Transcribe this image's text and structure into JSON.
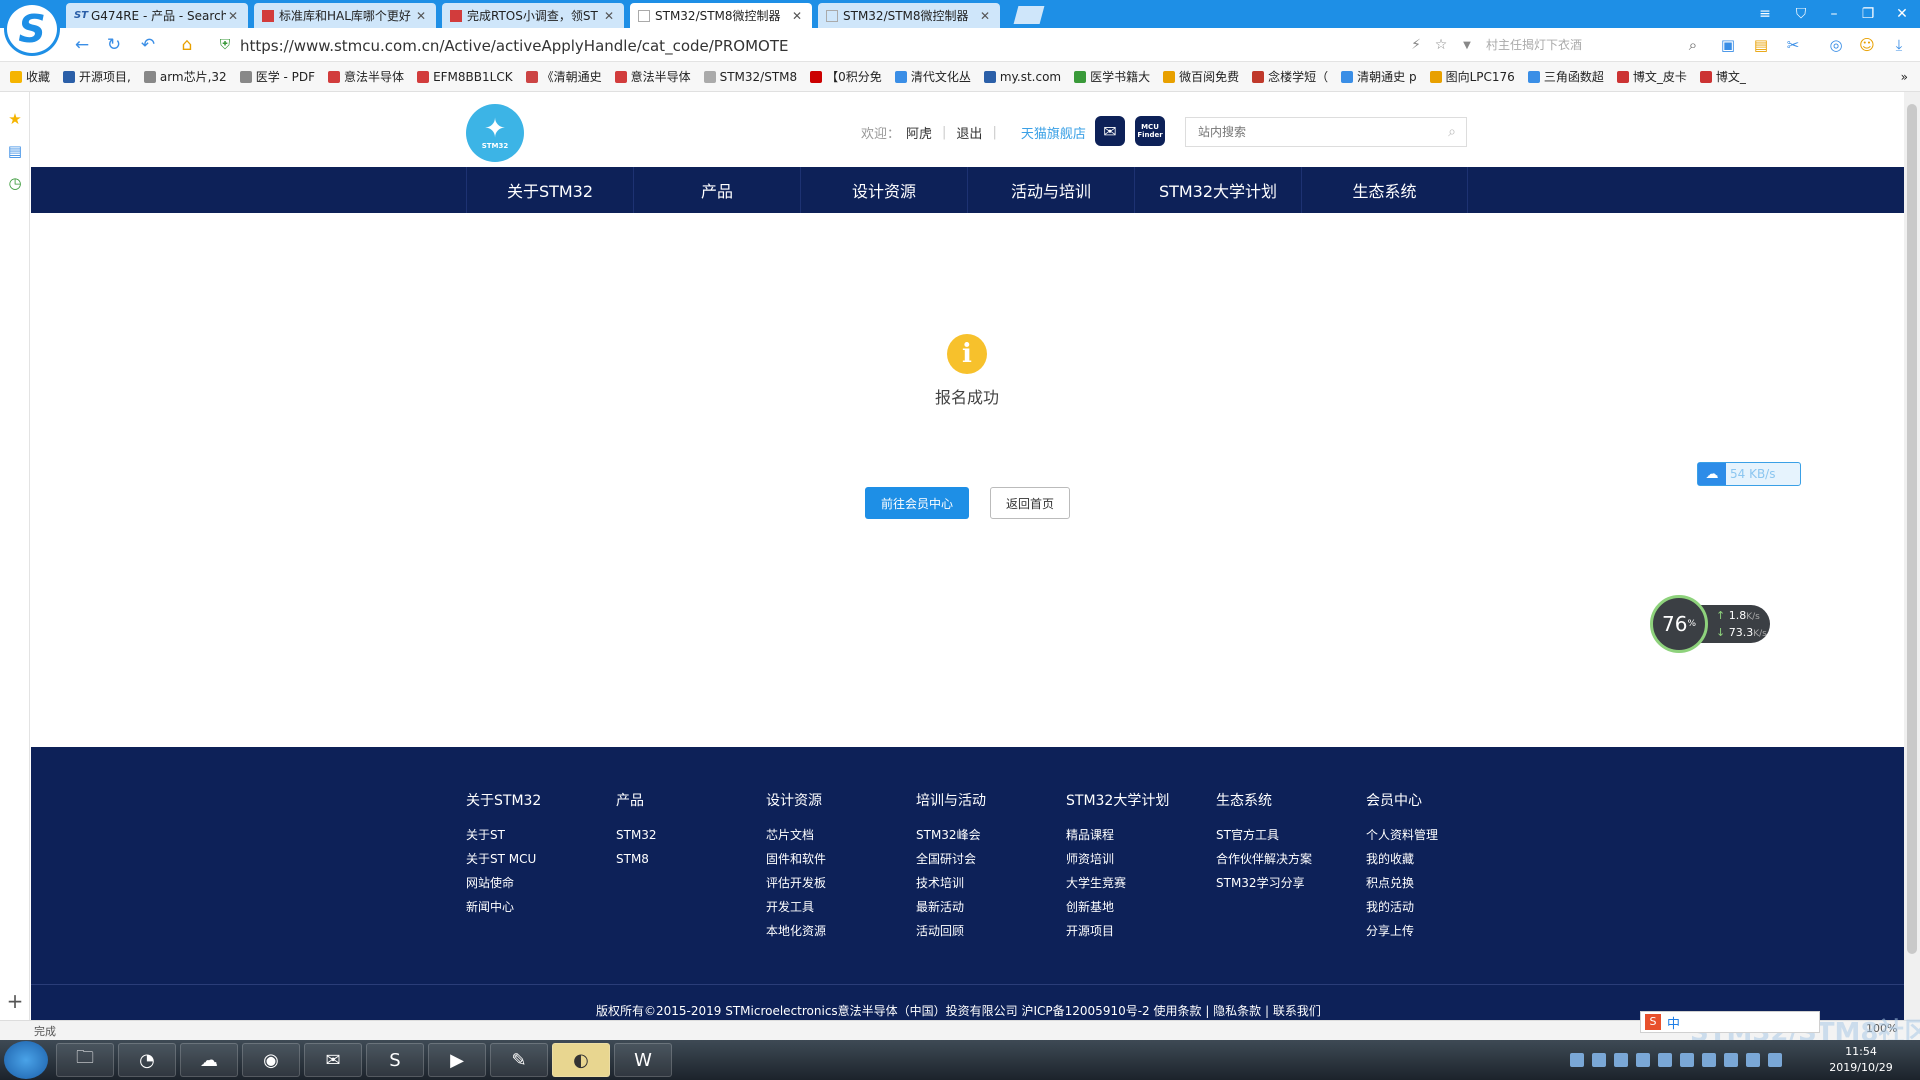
{
  "browser": {
    "logo": "S",
    "tabs": [
      {
        "label": "G474RE - 产品 - Search",
        "icon": "st-icon",
        "active": false
      },
      {
        "label": "标准库和HAL库哪个更好",
        "icon": "grid-icon",
        "active": false
      },
      {
        "label": "完成RTOS小调查，领ST",
        "icon": "grid-icon",
        "active": false
      },
      {
        "label": "STM32/STM8微控制器",
        "icon": "page-icon",
        "active": true
      },
      {
        "label": "STM32/STM8微控制器",
        "icon": "page-icon",
        "active": false
      }
    ],
    "url": "https://www.stmcu.com.cn/Active/activeApplyHandle/cat_code/PROMOTE",
    "search_placeholder": "村主任揭灯下衣酒",
    "bookmarks": [
      {
        "label": "收藏",
        "color": "#f5b400"
      },
      {
        "label": "开源项目,",
        "color": "#2b5fa8"
      },
      {
        "label": "arm芯片,32",
        "color": "#888888"
      },
      {
        "label": "医学 - PDF",
        "color": "#888888"
      },
      {
        "label": "意法半导体",
        "color": "#d23c3c"
      },
      {
        "label": "EFM8BB1LCK",
        "color": "#d23c3c"
      },
      {
        "label": "《清朝通史",
        "color": "#c44"
      },
      {
        "label": "意法半导体",
        "color": "#d23c3c"
      },
      {
        "label": "STM32/STM8",
        "color": "#aaaaaa"
      },
      {
        "label": "【0积分免",
        "color": "#cc0000"
      },
      {
        "label": "清代文化丛",
        "color": "#3a8ee6"
      },
      {
        "label": "my.st.com",
        "color": "#2b5fa8"
      },
      {
        "label": "医学书籍大",
        "color": "#3a9a3a"
      },
      {
        "label": "微百阅免费",
        "color": "#e8a000"
      },
      {
        "label": "念楼学短（",
        "color": "#c0392b"
      },
      {
        "label": "清朝通史 p",
        "color": "#3a8ee6"
      },
      {
        "label": "图向LPC176",
        "color": "#e8a000"
      },
      {
        "label": "三角函数超",
        "color": "#3a8ee6"
      },
      {
        "label": "博文_皮卡",
        "color": "#cc3333"
      },
      {
        "label": "博文_",
        "color": "#cc3333"
      }
    ],
    "status_text": "完成",
    "zoom": "100%"
  },
  "header": {
    "logo_text": "STM32",
    "welcome": "欢迎：",
    "username": "阿虎",
    "logout": "退出",
    "tmall": "天猫旗舰店",
    "wechat_icon": "wechat-icon",
    "mcu_finder": "MCU Finder",
    "search_placeholder": "站内搜索"
  },
  "nav": [
    {
      "label": "关于STM32"
    },
    {
      "label": "产品"
    },
    {
      "label": "设计资源"
    },
    {
      "label": "活动与培训"
    },
    {
      "label": "STM32大学计划"
    },
    {
      "label": "生态系统"
    }
  ],
  "content": {
    "info_icon": "i",
    "message": "报名成功",
    "btn_member": "前往会员中心",
    "btn_home": "返回首页"
  },
  "footer": {
    "columns": [
      {
        "title": "关于STM32",
        "items": [
          "关于ST",
          "关于ST MCU",
          "网站使命",
          "新闻中心"
        ]
      },
      {
        "title": "产品",
        "items": [
          "STM32",
          "STM8"
        ]
      },
      {
        "title": "设计资源",
        "items": [
          "芯片文档",
          "固件和软件",
          "评估开发板",
          "开发工具",
          "本地化资源"
        ]
      },
      {
        "title": "培训与活动",
        "items": [
          "STM32峰会",
          "全国研讨会",
          "技术培训",
          "最新活动",
          "活动回顾"
        ]
      },
      {
        "title": "STM32大学计划",
        "items": [
          "精品课程",
          "师资培训",
          "大学生竞赛",
          "创新基地",
          "开源项目"
        ]
      },
      {
        "title": "生态系统",
        "items": [
          "ST官方工具",
          "合作伙伴解决方案",
          "STM32学习分享"
        ]
      },
      {
        "title": "会员中心",
        "items": [
          "个人资料管理",
          "我的收藏",
          "积点兑换",
          "我的活动",
          "分享上传"
        ]
      }
    ],
    "copyright": "版权所有©2015-2019 STMicroelectronics意法半导体（中国）投资有限公司    沪ICP备12005910号-2    使用条款 | 隐私条款 | 联系我们"
  },
  "widgets": {
    "download_speed": "54 KB/s",
    "cpu_percent": "76",
    "up_speed": "1.8",
    "up_unit": "K/s",
    "down_speed": "73.3",
    "down_unit": "K/s"
  },
  "taskbar": {
    "time": "11:54",
    "date": "2019/10/29",
    "ime_label": "中",
    "watermark": "STM32/STM8社区"
  }
}
